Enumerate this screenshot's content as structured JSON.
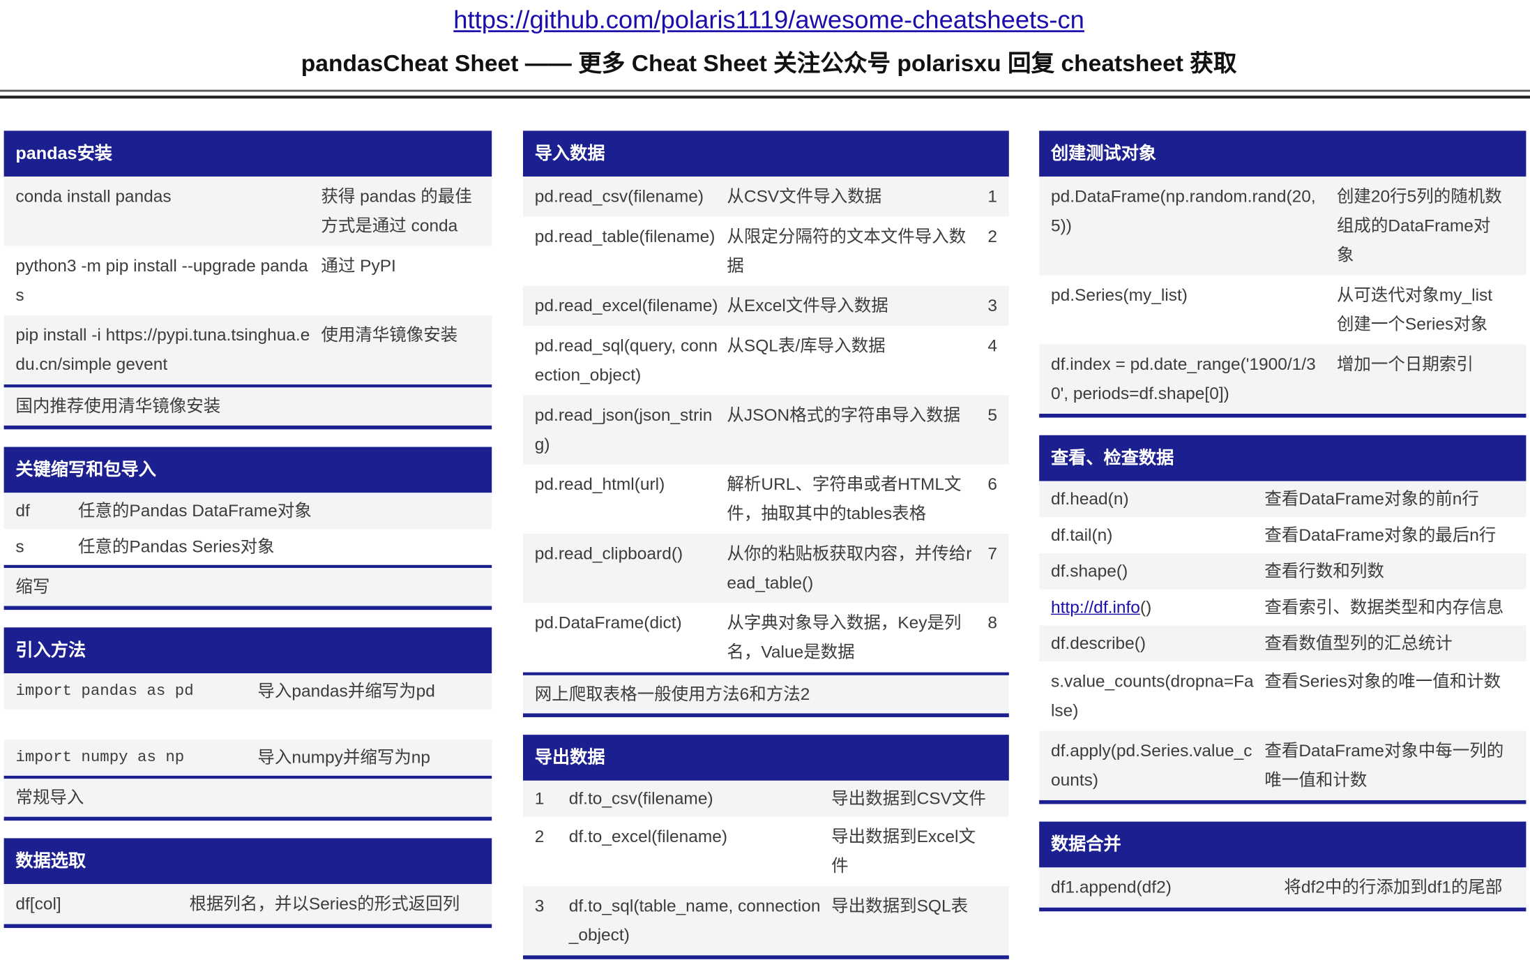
{
  "header": {
    "url": "https://github.com/polaris1119/awesome-cheatsheets-cn",
    "title": "pandasCheat Sheet —— 更多 Cheat Sheet 关注公众号 polarisxu 回复 cheatsheet 获取"
  },
  "install": {
    "title": "pandas安装",
    "rows": [
      {
        "code": "conda install pandas",
        "desc": "获得 pandas 的最佳方式是通过 conda"
      },
      {
        "code": "python3 -m pip install --upgrade pandas",
        "desc": "通过 PyPI"
      },
      {
        "code": "pip install -i https://pypi.tuna.tsinghua.edu.cn/simple gevent",
        "desc": "使用清华镜像安装"
      }
    ],
    "footer": "国内推荐使用清华镜像安装"
  },
  "abbrev": {
    "title": "关键缩写和包导入",
    "rows": [
      {
        "code": "df",
        "desc": "任意的Pandas DataFrame对象"
      },
      {
        "code": "s",
        "desc": "任意的Pandas Series对象"
      }
    ],
    "footer": "缩写"
  },
  "imports": {
    "title": "引入方法",
    "rows": [
      {
        "code": "import pandas as pd",
        "desc": "导入pandas并缩写为pd"
      },
      {
        "code": "import numpy as np",
        "desc": "导入numpy并缩写为np"
      }
    ],
    "footer": "常规导入"
  },
  "select": {
    "title": "数据选取",
    "rows": [
      {
        "code": "df[col]",
        "desc": "根据列名，并以Series的形式返回列"
      }
    ]
  },
  "import_data": {
    "title": "导入数据",
    "rows": [
      {
        "code": "pd.read_csv(filename)",
        "desc": "从CSV文件导入数据",
        "num": "1"
      },
      {
        "code": "pd.read_table(filename)",
        "desc": "从限定分隔符的文本文件导入数据",
        "num": "2"
      },
      {
        "code": "pd.read_excel(filename)",
        "desc": "从Excel文件导入数据",
        "num": "3"
      },
      {
        "code": "pd.read_sql(query, connection_object)",
        "desc": "从SQL表/库导入数据",
        "num": "4"
      },
      {
        "code": "pd.read_json(json_string)",
        "desc": "从JSON格式的字符串导入数据",
        "num": "5"
      },
      {
        "code": "pd.read_html(url)",
        "desc": "解析URL、字符串或者HTML文件，抽取其中的tables表格",
        "num": "6"
      },
      {
        "code": "pd.read_clipboard()",
        "desc": "从你的粘贴板获取内容，并传给read_table()",
        "num": "7"
      },
      {
        "code": "pd.DataFrame(dict)",
        "desc": "从字典对象导入数据，Key是列名，Value是数据",
        "num": "8"
      }
    ],
    "footer": "网上爬取表格一般使用方法6和方法2"
  },
  "export_data": {
    "title": "导出数据",
    "rows": [
      {
        "num": "1",
        "code": "df.to_csv(filename)",
        "desc": "导出数据到CSV文件"
      },
      {
        "num": "2",
        "code": "df.to_excel(filename)",
        "desc": "导出数据到Excel文件"
      },
      {
        "num": "3",
        "code": "df.to_sql(table_name, connection_object)",
        "desc": "导出数据到SQL表"
      }
    ]
  },
  "create": {
    "title": "创建测试对象",
    "rows": [
      {
        "code": "pd.DataFrame(np.random.rand(20,5))",
        "desc": "创建20行5列的随机数组成的DataFrame对象"
      },
      {
        "code": "pd.Series(my_list)",
        "desc": "从可迭代对象my_list创建一个Series对象"
      },
      {
        "code": "df.index = pd.date_range('1900/1/30', periods=df.shape[0])",
        "desc": "增加一个日期索引"
      }
    ]
  },
  "inspect": {
    "title": "查看、检查数据",
    "rows": [
      {
        "code": "df.head(n)",
        "desc": "查看DataFrame对象的前n行"
      },
      {
        "code": "df.tail(n)",
        "desc": "查看DataFrame对象的最后n行"
      },
      {
        "code": "df.shape()",
        "desc": "查看行数和列数"
      },
      {
        "code_link": "http://df.info",
        "code_tail": "()",
        "desc": "查看索引、数据类型和内存信息"
      },
      {
        "code": "df.describe()",
        "desc": "查看数值型列的汇总统计"
      },
      {
        "code": "s.value_counts(dropna=False)",
        "desc": "查看Series对象的唯一值和计数"
      },
      {
        "code": "df.apply(pd.Series.value_counts)",
        "desc": "查看DataFrame对象中每一列的唯一值和计数"
      }
    ]
  },
  "merge": {
    "title": "数据合并",
    "rows": [
      {
        "code": "df1.append(df2)",
        "desc": "将df2中的行添加到df1的尾部"
      }
    ]
  },
  "colors": {
    "accent": "#1b1f8f",
    "row_alt": "#f3f4f6",
    "link": "#1a0dab"
  }
}
